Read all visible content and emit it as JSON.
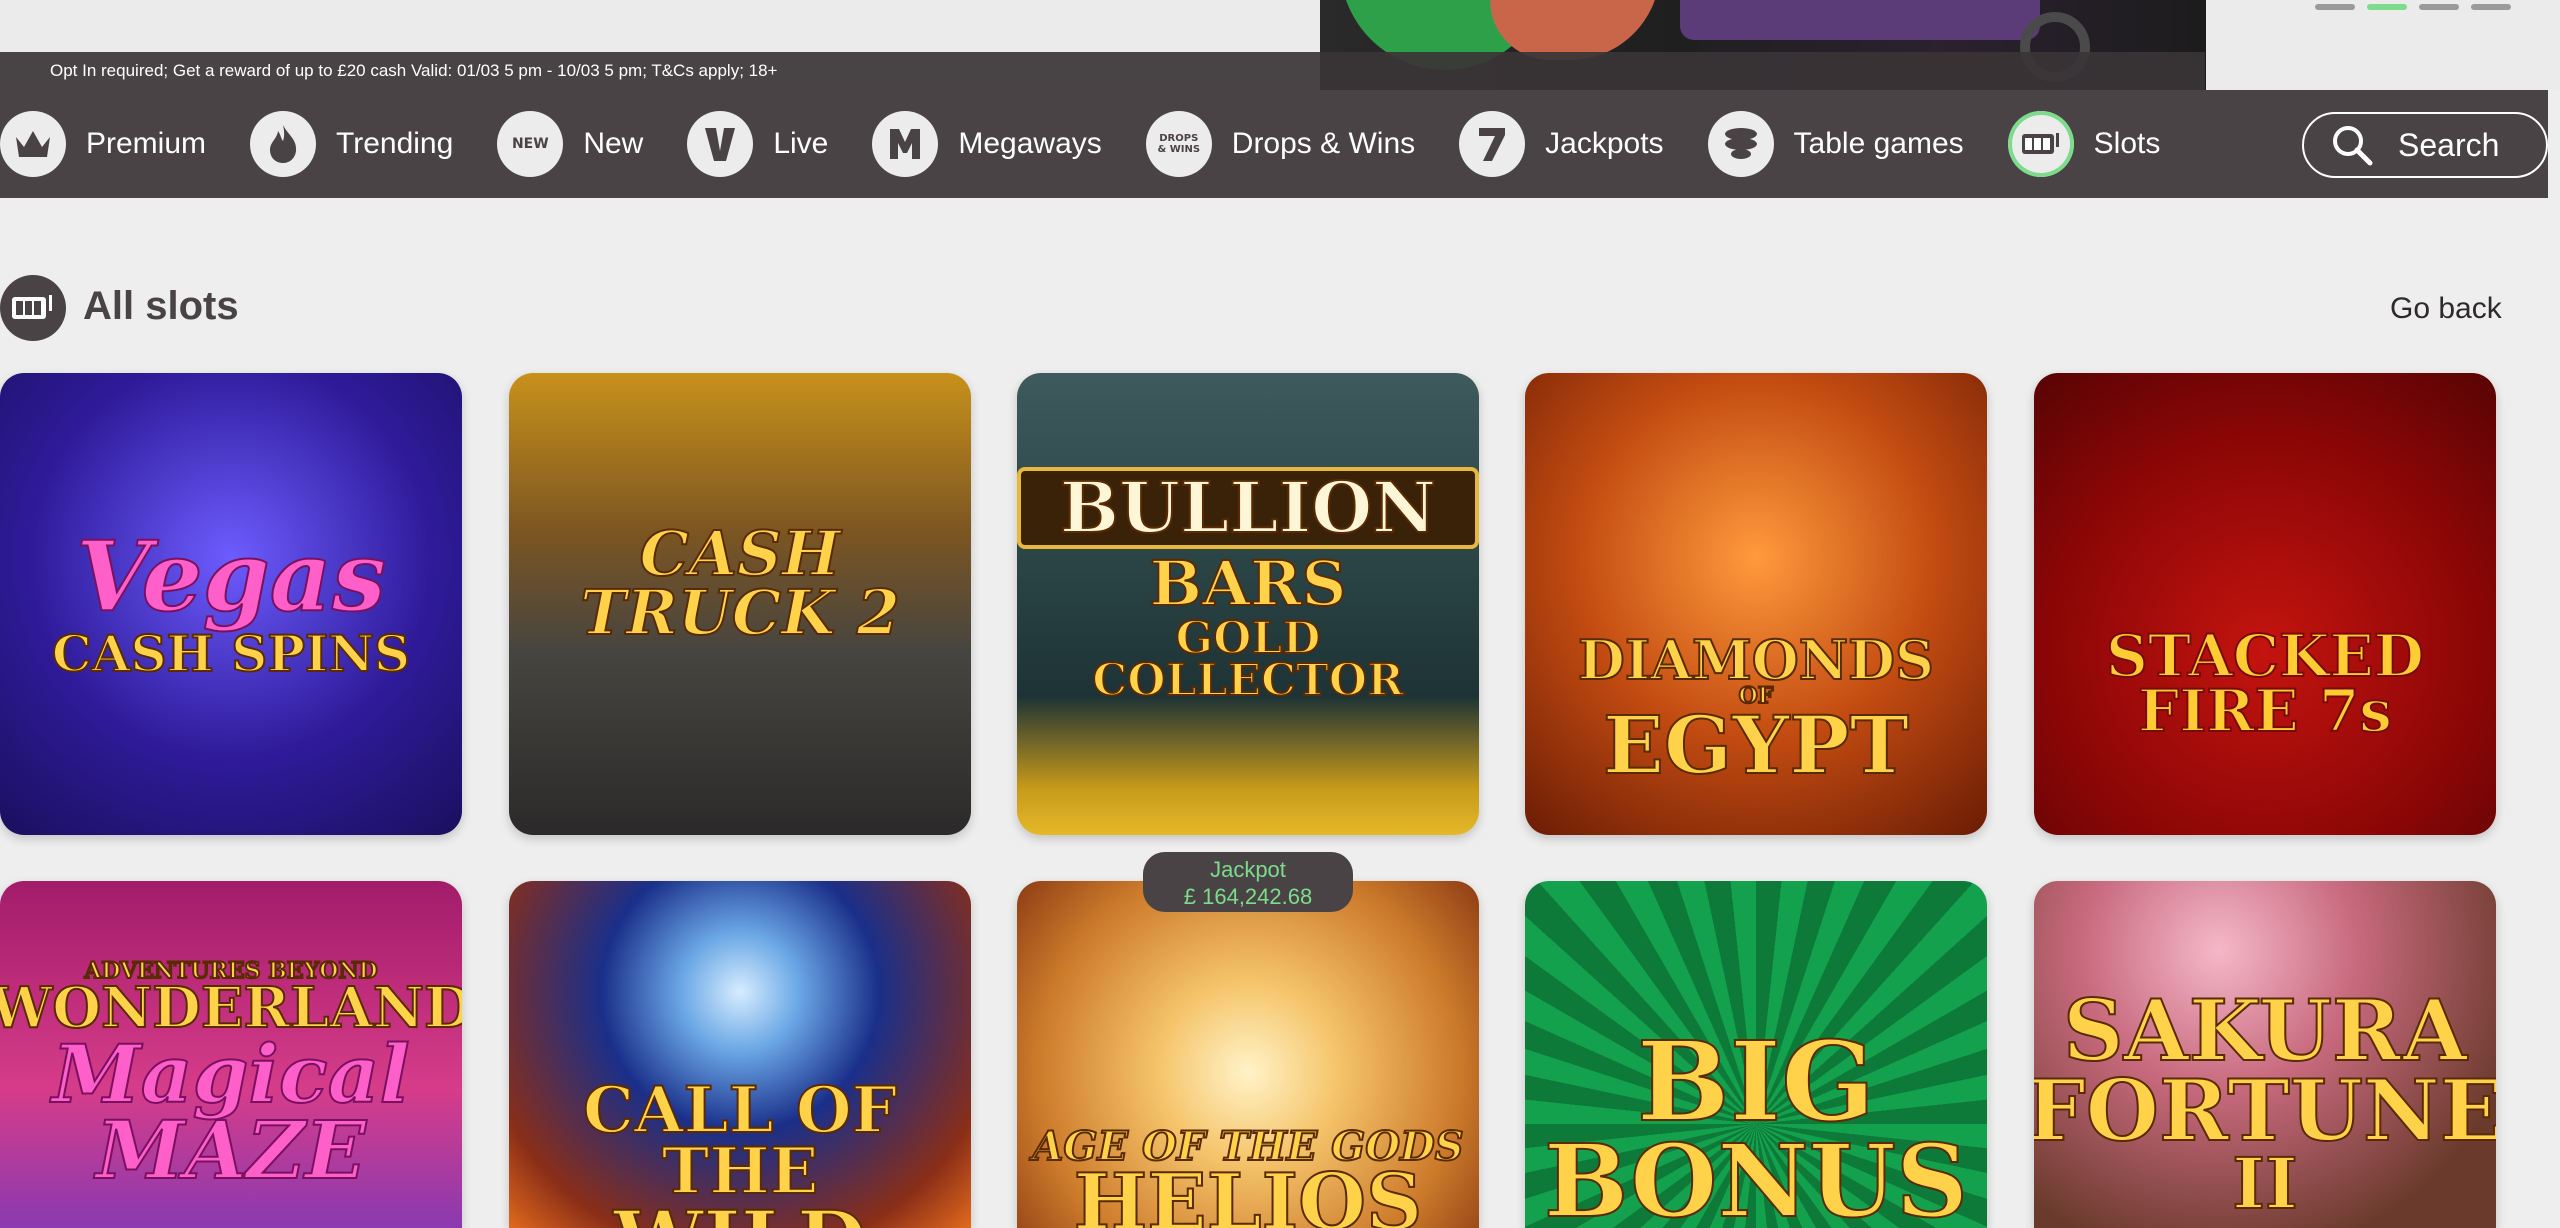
{
  "banner": {
    "terms": "Opt In required; Get a reward of up to £20 cash Valid: 01/03 5 pm - 10/03 5 pm; T&Cs apply; 18+",
    "slide_count": 4,
    "active_slide": 2
  },
  "nav": {
    "items": [
      {
        "label": "Premium",
        "icon": "crown-icon"
      },
      {
        "label": "Trending",
        "icon": "flame-icon"
      },
      {
        "label": "New",
        "icon": "new-badge-icon",
        "icon_text": "NEW"
      },
      {
        "label": "Live",
        "icon": "live-v-icon"
      },
      {
        "label": "Megaways",
        "icon": "megaways-m-icon"
      },
      {
        "label": "Drops & Wins",
        "icon": "drops-wins-icon",
        "icon_text": "DROPS & WINS"
      },
      {
        "label": "Jackpots",
        "icon": "seven-icon"
      },
      {
        "label": "Table games",
        "icon": "chips-icon"
      },
      {
        "label": "Slots",
        "icon": "slot-machine-icon",
        "active": true
      }
    ],
    "search_label": "Search"
  },
  "section": {
    "title": "All slots",
    "go_back": "Go back"
  },
  "games": [
    {
      "line1": "Vegas",
      "line2": "CASH SPINS"
    },
    {
      "line1": "CASH TRUCK 2",
      "line2": ""
    },
    {
      "line1": "BULLION",
      "line2": "BARS",
      "line3": "GOLD COLLECTOR"
    },
    {
      "line1": "DIAMONDS",
      "line2": "OF",
      "line3": "EGYPT"
    },
    {
      "line1": "STACKED FIRE 7s",
      "line2": ""
    },
    {
      "line1": "ADVENTURES BEYOND",
      "line2": "WONDERLAND",
      "line3": "Magical MAZE"
    },
    {
      "line1": "CALL OF THE",
      "line2": "WILD"
    },
    {
      "line1": "AGE OF THE GODS",
      "line2": "HELIOS"
    },
    {
      "line1": "BIG",
      "line2": "BONUS"
    },
    {
      "line1": "SAKURA",
      "line2": "FORTUNE",
      "line3": "II"
    }
  ],
  "jackpot": {
    "label": "Jackpot",
    "amount": "£ 164,242.68"
  },
  "colors": {
    "nav_bg": "#4a4346",
    "accent_green": "#7ddc8b",
    "page_bg": "#eeeeee"
  }
}
